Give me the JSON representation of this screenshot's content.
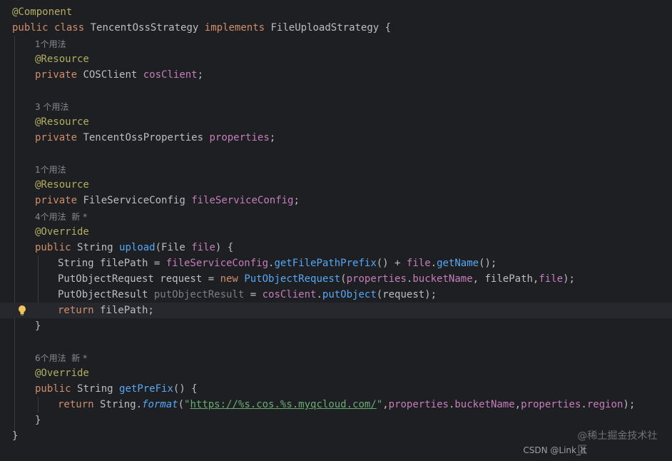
{
  "top_hint": "新",
  "code": {
    "class_annotation": "@Component",
    "kw_public": "public",
    "kw_class": "class",
    "class_name": "TencentOssStrategy",
    "kw_implements": "implements",
    "interface_name": "FileUploadStrategy",
    "brace_open": " {",
    "brace_close": "}",
    "field1_usage": "1个用法",
    "resource": "@Resource",
    "kw_private": "private",
    "field1_type": "COSClient",
    "field1_name": "cosClient",
    "semicolon": ";",
    "field2_usage": "3 个用法",
    "field2_type": "TencentOssProperties",
    "field2_name": "properties",
    "field3_usage": "1个用法",
    "field3_type": "FileServiceConfig",
    "field3_name": "fileServiceConfig",
    "method1_usage": "4个用法  新 *",
    "override": "@Override",
    "m1_ret": "String",
    "m1_name": "upload",
    "m1_params_open": "(File ",
    "m1_param": "file",
    "m1_params_close": ") {",
    "l1_decl": "String filePath = ",
    "l1_field": "fileServiceConfig",
    "l1_call": "getFilePathPrefix",
    "l1_mid": "() + ",
    "l1_file": "file",
    "l1_call2": "getName",
    "l1_end": "();",
    "l2_decl": "PutObjectRequest request = ",
    "l2_new": "new",
    "l2_ctor": "PutObjectRequest",
    "l2_props": "properties",
    "l2_bucket": "bucketName",
    "l2_mid": ", filePath,",
    "l2_file": "file",
    "l2_end": ");",
    "l3_type": "PutObjectResult ",
    "l3_var": "putObjectResult",
    "l3_eq": " = ",
    "l3_client": "cosClient",
    "l3_call": "putObject",
    "l3_end": "(request);",
    "kw_return": "return",
    "l4_val": " filePath;",
    "method2_usage": "6个用法  新 *",
    "m2_ret": "String",
    "m2_name": "getPreFix",
    "m2_params": "() {",
    "l5_string_cls": " String.",
    "l5_fn": "format",
    "l5_open": "(",
    "l5_q": "\"",
    "l5_url": "https://%s.cos.%s.myqcloud.com/",
    "l5_props": "properties",
    "l5_bucket": "bucketName",
    "l5_region": "region",
    "l5_end": ");"
  },
  "watermark": "@稀土掘金技术社区",
  "watermark2": "CSDN @Link_lt",
  "colors": {
    "background": "#1e1f22",
    "keyword": "#cf8e6d",
    "annotation": "#b3ae60",
    "field": "#c77dbb",
    "method": "#56a8f5",
    "string": "#6aab73"
  },
  "icons": {
    "intention": "lightbulb-icon"
  }
}
